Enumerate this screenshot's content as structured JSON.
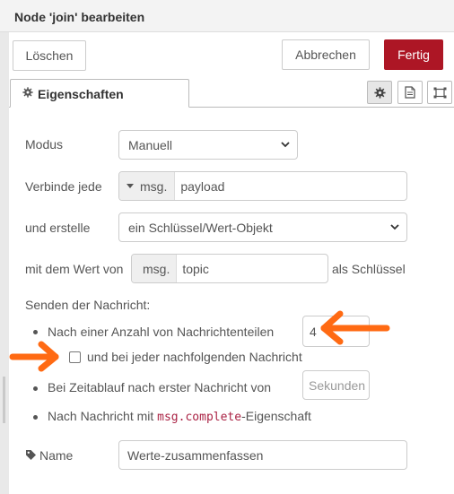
{
  "dialog": {
    "title": "Node 'join' bearbeiten",
    "delete_label": "Löschen",
    "cancel_label": "Abbrechen",
    "done_label": "Fertig"
  },
  "tabs": [
    {
      "label": "Eigenschaften",
      "icon": "gear-icon",
      "active": true
    }
  ],
  "tab_icons": [
    "gear-icon",
    "document-icon",
    "frame-icon"
  ],
  "form": {
    "mode": {
      "label": "Modus",
      "value": "Manuell"
    },
    "combine": {
      "label": "Verbinde jede",
      "type": "msg.",
      "value": "payload"
    },
    "create": {
      "label": "und erstelle",
      "value": "ein Schlüssel/Wert-Objekt"
    },
    "keyvalue": {
      "label": "mit dem Wert von",
      "type": "msg.",
      "value": "topic",
      "suffix": "als Schlüssel"
    },
    "send": {
      "heading": "Senden der Nachricht:",
      "count_label": "Nach einer Anzahl von Nachrichtenteilen",
      "count_value": "4",
      "every_label": "und bei jeder nachfolgenden Nachricht",
      "every_checked": false,
      "timeout_label": "Bei Zeitablauf nach erster Nachricht von",
      "timeout_placeholder": "Sekunden",
      "complete_prefix": "Nach Nachricht mit ",
      "complete_code": "msg.complete",
      "complete_suffix": "-Eigenschaft"
    },
    "name": {
      "label": "Name",
      "value": "Werte-zusammenfassen",
      "icon": "tag-icon"
    }
  },
  "annotations": {
    "arrow_color": "#ff6a13",
    "arrows": [
      "arrow-pointing-to-count-input",
      "arrow-pointing-to-checkbox"
    ]
  },
  "colors": {
    "primary": "#ad1625",
    "header_bg": "#f3f3f3",
    "code": "#aa2244"
  }
}
